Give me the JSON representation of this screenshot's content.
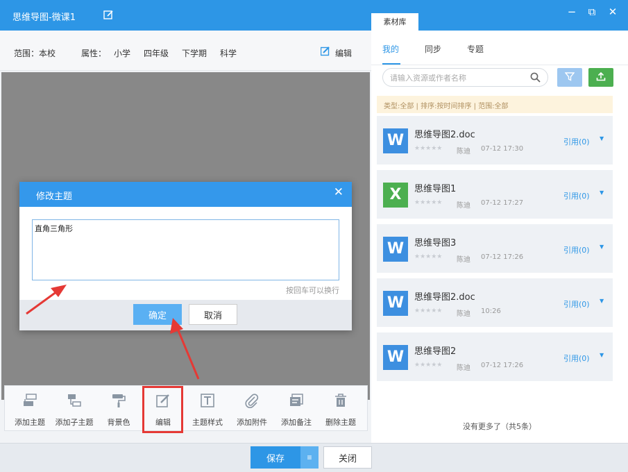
{
  "window": {
    "title": "思维导图-微课1",
    "minimize": "−",
    "maximize": "⧉",
    "close": "✕"
  },
  "scope": {
    "range": "范围：本校",
    "attr_label": "属性：",
    "attrs": [
      "小学",
      "四年级",
      "下学期",
      "科学"
    ],
    "edit_label": "编辑"
  },
  "modal": {
    "title": "修改主题",
    "close": "✕",
    "value": "直角三角形",
    "hint": "按回车可以换行",
    "ok_label": "确定",
    "cancel_label": "取消"
  },
  "toolbar": {
    "tools": [
      {
        "label": "添加主题",
        "icon": "add-topic-icon"
      },
      {
        "label": "添加子主题",
        "icon": "add-subtopic-icon"
      },
      {
        "label": "背景色",
        "icon": "paint-roller-icon"
      },
      {
        "label": "编辑",
        "icon": "edit-icon"
      },
      {
        "label": "主题样式",
        "icon": "text-style-icon"
      },
      {
        "label": "添加附件",
        "icon": "paperclip-icon"
      },
      {
        "label": "添加备注",
        "icon": "note-icon"
      },
      {
        "label": "删除主题",
        "icon": "trash-icon"
      }
    ]
  },
  "bottom": {
    "save_label": "保存",
    "save_dropdown": "≡",
    "close_label": "关闭"
  },
  "library": {
    "tab_label": "素材库",
    "subtabs": [
      "我的",
      "同步",
      "专题"
    ],
    "active_subtab": "我的",
    "search_placeholder": "请输入资源或作者名称",
    "filter_text": "类型:全部 | 排序:按时间排序 | 范围:全部",
    "items": [
      {
        "name": "思维导图2.doc",
        "type": "W",
        "color": "#3d8fe0",
        "stars": "★★★★★",
        "author": "陈迪",
        "date": "07-12 17:30",
        "cite": "引用(0)"
      },
      {
        "name": "思维导图1",
        "type": "X",
        "color": "#4caf50",
        "stars": "★★★★★",
        "author": "陈迪",
        "date": "07-12 17:27",
        "cite": "引用(0)"
      },
      {
        "name": "思维导图3",
        "type": "W",
        "color": "#3d8fe0",
        "stars": "★★★★★",
        "author": "陈迪",
        "date": "07-12 17:26",
        "cite": "引用(0)"
      },
      {
        "name": "思维导图2.doc",
        "type": "W",
        "color": "#3d8fe0",
        "stars": "★★★★★",
        "author": "陈迪",
        "date": "10:26",
        "cite": "引用(0)"
      },
      {
        "name": "思维导图2",
        "type": "W",
        "color": "#3d8fe0",
        "stars": "★★★★★",
        "author": "陈迪",
        "date": "07-12 17:26",
        "cite": "引用(0)"
      }
    ],
    "no_more": "没有更多了（共5条）"
  },
  "colors": {
    "accent": "#2d96e6",
    "annotation": "#e53935"
  }
}
